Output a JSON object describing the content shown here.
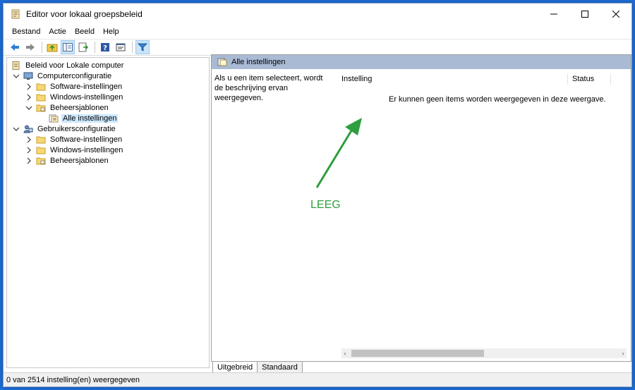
{
  "window": {
    "title": "Editor voor lokaal groepsbeleid"
  },
  "menubar": {
    "items": [
      "Bestand",
      "Actie",
      "Beeld",
      "Help"
    ]
  },
  "toolbar": {
    "buttons": [
      "back-icon",
      "forward-icon",
      "up-folder-icon",
      "show-hide-tree-icon",
      "export-list-icon",
      "help-icon",
      "properties-icon",
      "filter-icon"
    ]
  },
  "tree": {
    "root": "Beleid voor Lokale computer",
    "items": [
      {
        "label": "Computerconfiguratie",
        "level": 1,
        "icon": "computer-icon",
        "expanded": true
      },
      {
        "label": "Software-instellingen",
        "level": 2,
        "icon": "folder-icon",
        "expanded": false
      },
      {
        "label": "Windows-instellingen",
        "level": 2,
        "icon": "folder-icon",
        "expanded": false
      },
      {
        "label": "Beheersjablonen",
        "level": 2,
        "icon": "folder-icon",
        "expanded": true
      },
      {
        "label": "Alle instellingen",
        "level": 3,
        "icon": "settings-page-icon",
        "selected": true
      },
      {
        "label": "Gebruikersconfiguratie",
        "level": 1,
        "icon": "user-icon",
        "expanded": true
      },
      {
        "label": "Software-instellingen",
        "level": 2,
        "icon": "folder-icon",
        "expanded": false
      },
      {
        "label": "Windows-instellingen",
        "level": 2,
        "icon": "folder-icon",
        "expanded": false
      },
      {
        "label": "Beheersjablonen",
        "level": 2,
        "icon": "folder-icon",
        "expanded": false
      }
    ]
  },
  "pane": {
    "header": "Alle instellingen",
    "description": "Als u een item selecteert, wordt de beschrijving ervan weergegeven.",
    "columns": [
      "Instelling",
      "Status"
    ],
    "empty_message": "Er kunnen geen items worden weergegeven in deze weergave."
  },
  "tabs": [
    "Uitgebreid",
    "Standaard"
  ],
  "statusbar": {
    "text": "0 van 2514 instelling(en) weergegeven"
  },
  "annotation": {
    "label": "LEEG",
    "color": "#2e9e3e"
  },
  "colors": {
    "accent": "#1e6fd9",
    "selection": "#cce8ff",
    "pane_header": "#a9bad4"
  }
}
